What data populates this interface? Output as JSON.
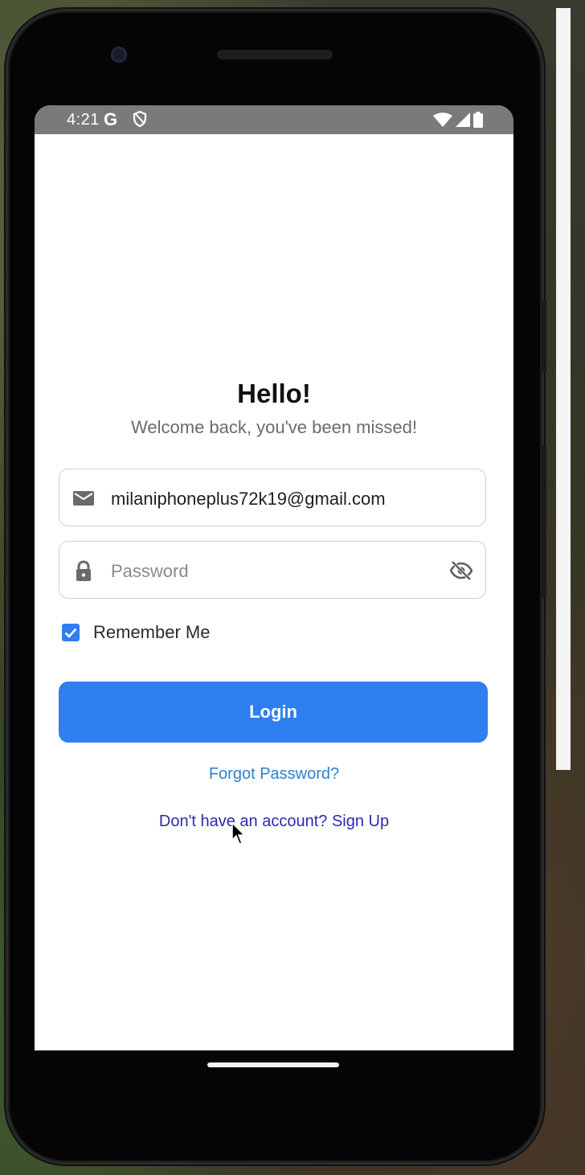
{
  "status_bar": {
    "time": "4:21",
    "google_glyph": "G",
    "icons": [
      "shield-icon",
      "wifi-icon",
      "signal-icon",
      "battery-icon"
    ]
  },
  "login": {
    "title": "Hello!",
    "subtitle": "Welcome back, you've been missed!",
    "email": {
      "value": "milaniphoneplus72k19@gmail.com",
      "icon": "mail-icon"
    },
    "password": {
      "value": "",
      "placeholder": "Password",
      "icon": "lock-icon",
      "toggle_icon": "eye-off-icon"
    },
    "remember_me": {
      "label": "Remember Me",
      "checked": true
    },
    "login_button": "Login",
    "forgot_password": "Forgot Password?",
    "signup_prompt": "Don't have an account? Sign Up"
  },
  "colors": {
    "primary": "#2f7ff0",
    "link_forgot": "#2f7fd0",
    "link_signup": "#2a2ab0",
    "status_bar": "#7a7a7a"
  }
}
